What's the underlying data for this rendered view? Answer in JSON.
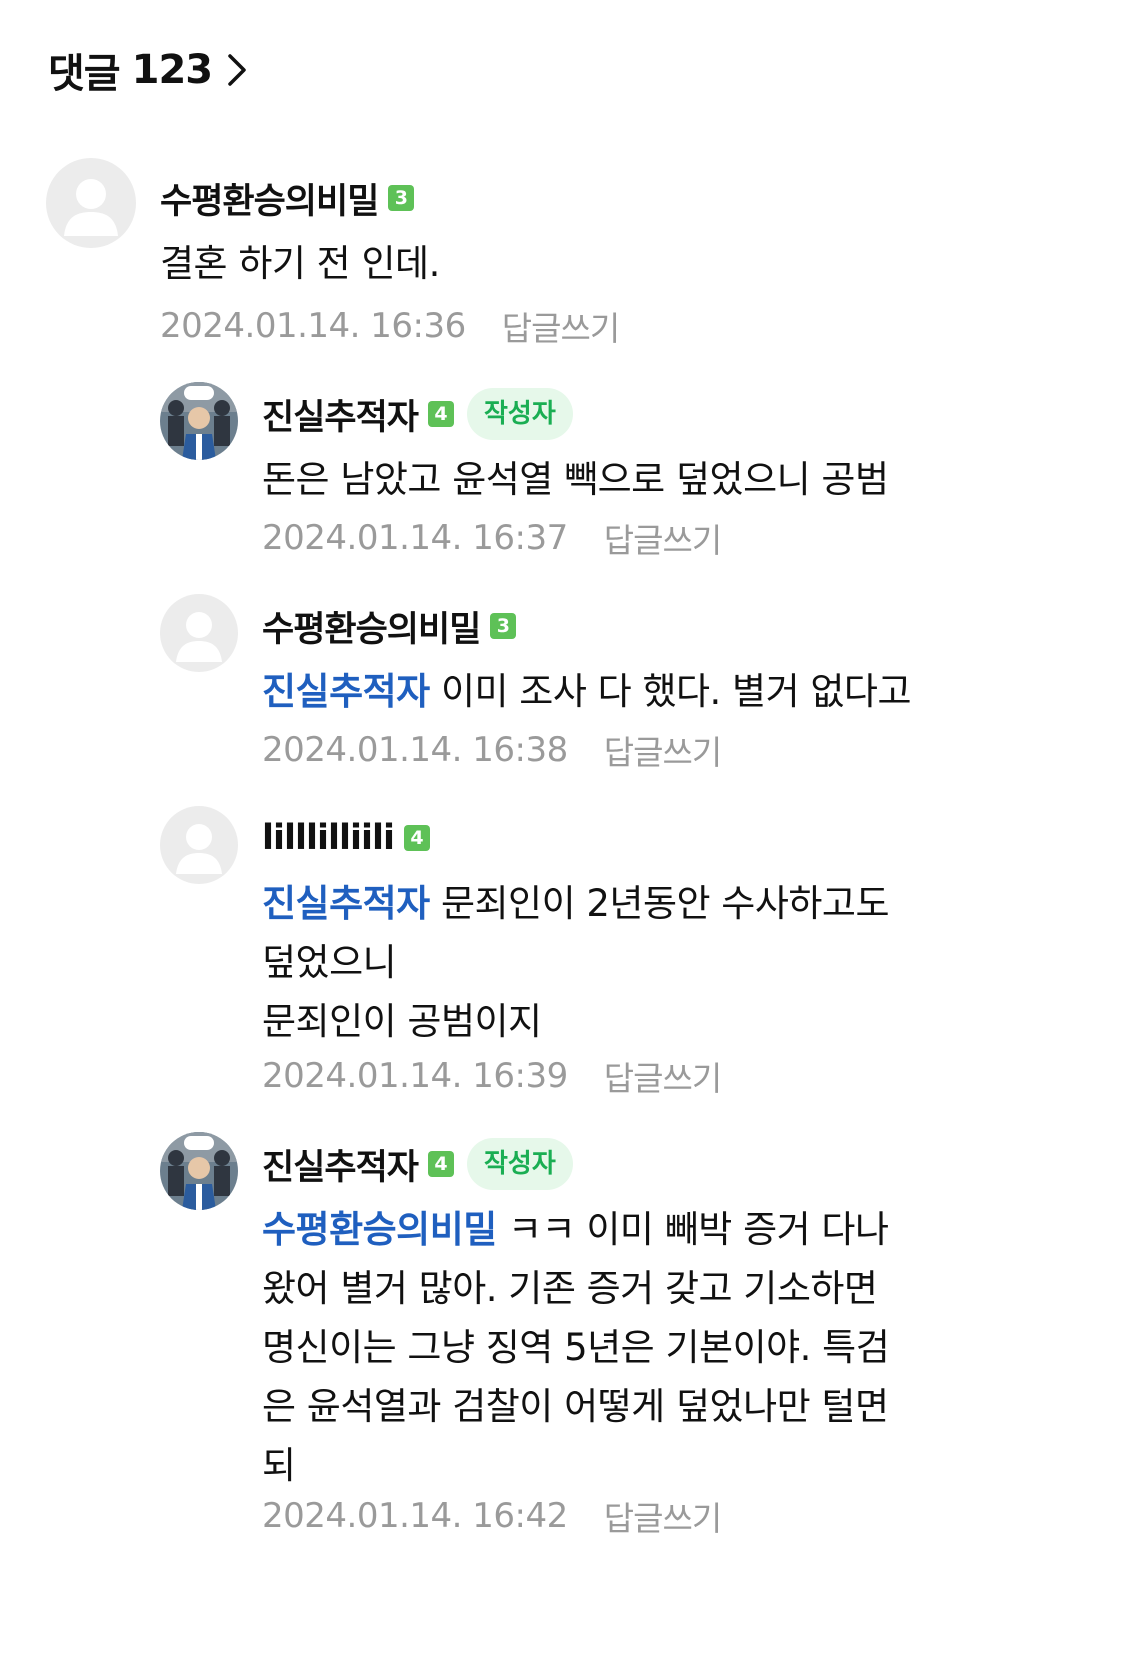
{
  "header": {
    "title": "댓글",
    "count": "123"
  },
  "colors": {
    "level_badge": "#5ec157",
    "author_tag_bg": "#e6f8ea",
    "author_tag_text": "#1aae53",
    "mention": "#1f5fbf",
    "meta_text": "#9a9a9a"
  },
  "icons": {
    "header_chevron": "chevron-right-icon",
    "avatar_default": "default-user-icon"
  },
  "comments": [
    {
      "author": "수평환승의비밀",
      "level": "3",
      "text": "결혼 하기 전 인데.",
      "date": "2024.01.14. 16:36",
      "reply_label": "답글쓰기"
    },
    {
      "author": "진실추적자",
      "level": "4",
      "author_tag": "작성자",
      "text": "돈은 남았고 윤석열 빽으로 덮었으니 공범",
      "date": "2024.01.14. 16:37",
      "reply_label": "답글쓰기"
    },
    {
      "author": "수평환승의비밀",
      "level": "3",
      "mention": "진실추적자",
      "text": " 이미 조사 다 했다. 별거 없다고",
      "date": "2024.01.14. 16:38",
      "reply_label": "답글쓰기"
    },
    {
      "author": "lilllilliili",
      "level": "4",
      "mention": "진실추적자",
      "text_lines": [
        " 문죄인이 2년동안 수사하고도",
        "덮었으니",
        "문죄인이 공범이지"
      ],
      "date": "2024.01.14. 16:39",
      "reply_label": "답글쓰기"
    },
    {
      "author": "진실추적자",
      "level": "4",
      "author_tag": "작성자",
      "mention": "수평환승의비밀",
      "text_lines": [
        " ㅋㅋ 이미 빼박 증거 다나",
        "왔어 별거 많아. 기존 증거 갖고 기소하면",
        "명신이는 그냥 징역 5년은 기본이야. 특검",
        "은 윤석열과 검찰이 어떻게 덮었나만 털면",
        "되"
      ],
      "date": "2024.01.14. 16:42",
      "reply_label": "답글쓰기"
    }
  ]
}
